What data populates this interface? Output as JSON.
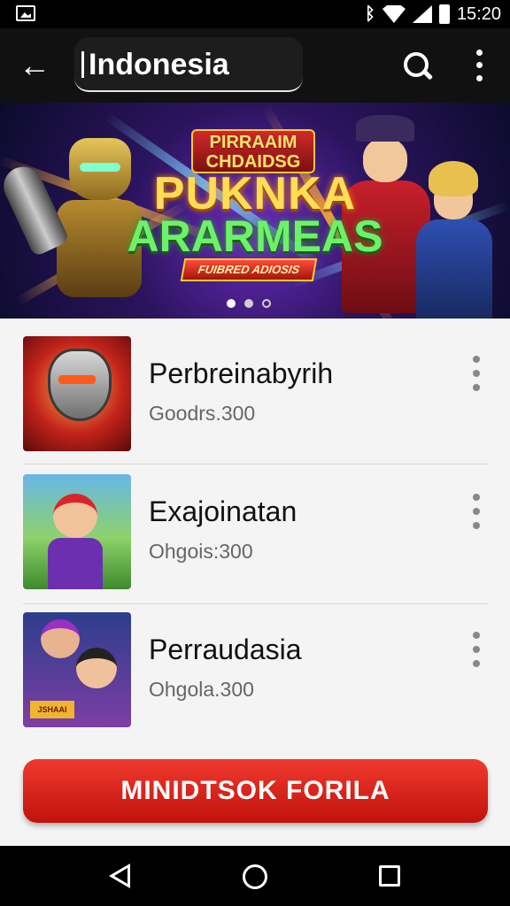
{
  "status_bar": {
    "time": "15:20",
    "bluetooth_symbol": "ᛒ"
  },
  "app_bar": {
    "back_symbol": "←",
    "title": "Indonesia"
  },
  "banner": {
    "top_line1": "PIRRAAIM",
    "top_line2": "CHDAIDSG",
    "main_line1": "PUKNKA",
    "main_line2": "ARARMEAS",
    "ribbon": "FUIBRED ADIOSIS"
  },
  "list": [
    {
      "title": "Perbreinabyrih",
      "subtitle": "Goodrs.300"
    },
    {
      "title": "Exajoinatan",
      "subtitle": "Ohgois:300"
    },
    {
      "title": "Perraudasia",
      "subtitle": "Ohgola.300",
      "thumb_text": "JSHAAI"
    }
  ],
  "cta_button": "MINIDTSOK FORILA",
  "colors": {
    "accent": "#d81f17",
    "app_bar": "#111111"
  }
}
